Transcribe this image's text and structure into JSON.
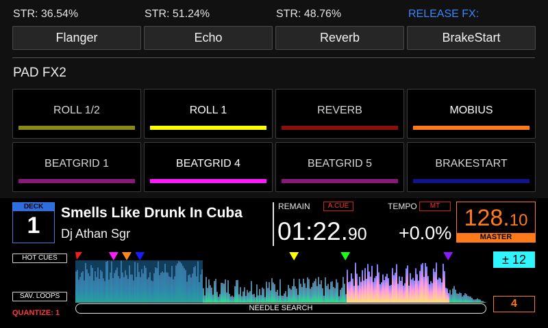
{
  "fx_strength": [
    {
      "label": "STR: 36.54%"
    },
    {
      "label": "STR: 51.24%"
    },
    {
      "label": "STR: 48.76%"
    },
    {
      "label": "RELEASE FX:",
      "color": "#3a86ff"
    }
  ],
  "fx_buttons": [
    "Flanger",
    "Echo",
    "Reverb",
    "BrakeStart"
  ],
  "pad_fx": {
    "title": "PAD FX2",
    "pads": [
      {
        "label": "ROLL 1/2",
        "color": "#8a8a1a"
      },
      {
        "label": "ROLL 1",
        "color": "#ffff00"
      },
      {
        "label": "REVERB",
        "color": "#8a1010"
      },
      {
        "label": "MOBIUS",
        "color": "#ff7a1a"
      },
      {
        "label": "BEATGRID 1",
        "color": "#8a1a7a"
      },
      {
        "label": "BEATGRID 4",
        "color": "#ff1aff"
      },
      {
        "label": "BEATGRID 5",
        "color": "#8a1a7a"
      },
      {
        "label": "BRAKESTART",
        "color": "#12128a"
      }
    ]
  },
  "deck": {
    "label": "DECK",
    "number": "1",
    "track_title": "Smells Like Drunk In Cuba",
    "artist": "Dj Athan Sgr",
    "remain_label": "REMAIN",
    "acue": "A.CUE",
    "time_main": "01:22.",
    "time_frac": "90",
    "tempo_label": "TEMPO",
    "mt": "MT",
    "tempo_value": "+0.0%",
    "bpm_main": "128.",
    "bpm_frac": "10",
    "master_label": "MASTER"
  },
  "waveform": {
    "hot_cues_label": "HOT CUES",
    "sav_loops_label": "SAV. LOOPS",
    "quantize": "QUANTIZE: 1",
    "needle_label": "NEEDLE SEARCH",
    "key": "± 12",
    "loop": "4",
    "played_fraction": 0.31,
    "hot_cue_markers": [
      {
        "pos": 0.005,
        "color": "#ff1a1a"
      },
      {
        "pos": 0.093,
        "color": "#ff1aff"
      },
      {
        "pos": 0.125,
        "color": "#ff8a1a"
      },
      {
        "pos": 0.157,
        "color": "#1a1aff"
      },
      {
        "pos": 0.532,
        "color": "#ffff00"
      },
      {
        "pos": 0.657,
        "color": "#1aff1a"
      },
      {
        "pos": 0.907,
        "color": "#8a1aff"
      }
    ]
  }
}
